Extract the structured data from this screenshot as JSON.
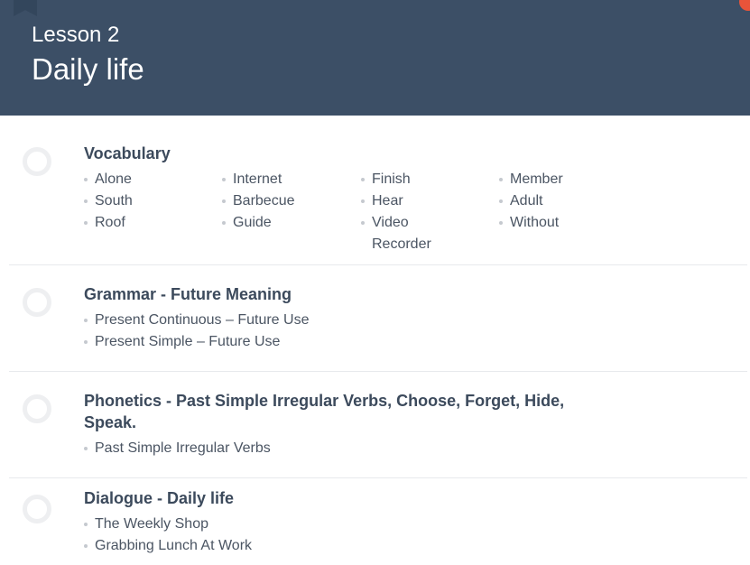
{
  "header": {
    "lesson_label": "Lesson 2",
    "title": "Daily life"
  },
  "sections": [
    {
      "title": "Vocabulary",
      "items": [
        "Alone",
        "South",
        "Roof",
        "Internet",
        "Barbecue",
        "Guide",
        "Finish",
        "Hear",
        "Video",
        "Recorder",
        "Member",
        "Adult",
        "Without"
      ]
    },
    {
      "title": "Grammar - Future Meaning",
      "items": [
        "Present Continuous – Future Use",
        "Present Simple – Future Use"
      ]
    },
    {
      "title_line1": "Phonetics - Past Simple Irregular Verbs, Choose, Forget, Hide,",
      "title_line2": "Speak.",
      "items": [
        "Past Simple Irregular Verbs"
      ]
    },
    {
      "title": "Dialogue - Daily life",
      "items": [
        "The Weekly Shop",
        "Grabbing Lunch At Work"
      ]
    }
  ]
}
